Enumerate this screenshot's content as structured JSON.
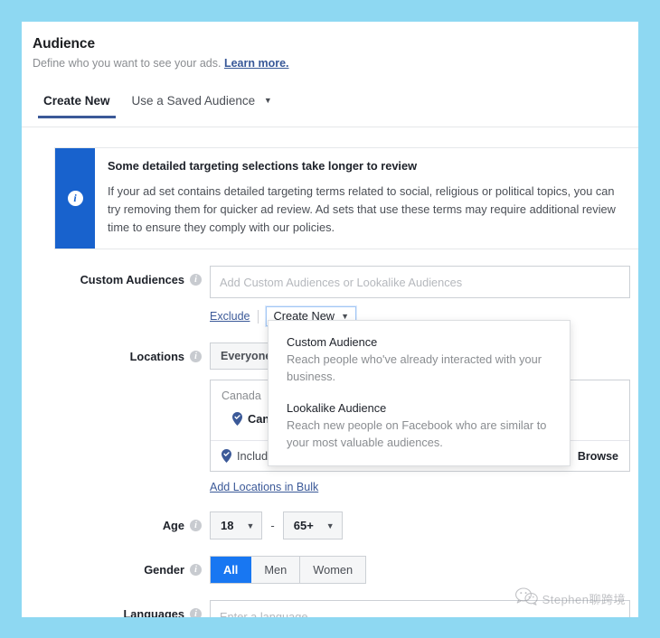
{
  "theme": {
    "page_background": "#8ed8f2",
    "card_background": "#ffffff",
    "brand_blue": "#1877f2",
    "banner_blue": "#1862cd",
    "link_blue": "#3b5998",
    "tab_underline": "#3b5998"
  },
  "header": {
    "title": "Audience",
    "subtitle": "Define who you want to see your ads.",
    "learn_more": "Learn more."
  },
  "tabs": [
    {
      "label": "Create New",
      "active": true
    },
    {
      "label": "Use a Saved Audience",
      "active": false,
      "caret": "▼"
    }
  ],
  "banner": {
    "icon": "info-icon",
    "icon_glyph": "i",
    "title": "Some detailed targeting selections take longer to review",
    "text": "If your ad set contains detailed targeting terms related to social, religious or political topics, you can try removing them for quicker ad review. Ad sets that use these terms may require additional review time to ensure they comply with our policies."
  },
  "custom_audiences": {
    "label": "Custom Audiences",
    "help_icon": "question-mark-icon",
    "placeholder": "Add Custom Audiences or Lookalike Audiences",
    "value": "",
    "exclude_label": "Exclude",
    "create_new_label": "Create New",
    "create_new_caret": "▼"
  },
  "create_new_dropdown": {
    "items": [
      {
        "title": "Custom Audience",
        "description": "Reach people who've already interacted with your business."
      },
      {
        "title": "Lookalike Audience",
        "description": "Reach new people on Facebook who are similar to your most valuable audiences."
      }
    ]
  },
  "locations": {
    "label": "Locations",
    "help_icon": "question-mark-icon",
    "scope_button": "Everyone",
    "country_group": "Canada",
    "selected_chip": "Canada",
    "include_label": "Include",
    "browse_label": "Browse",
    "bulk_link": "Add Locations in Bulk",
    "pin_icon": "map-pin-icon"
  },
  "age": {
    "label": "Age",
    "help_icon": "question-mark-icon",
    "min": "18",
    "max": "65+",
    "separator": "-",
    "caret": "▼"
  },
  "gender": {
    "label": "Gender",
    "help_icon": "question-mark-icon",
    "options": [
      {
        "label": "All",
        "selected": true
      },
      {
        "label": "Men",
        "selected": false
      },
      {
        "label": "Women",
        "selected": false
      }
    ]
  },
  "languages": {
    "label": "Languages",
    "help_icon": "question-mark-icon",
    "placeholder": "Enter a language...",
    "value": ""
  },
  "watermark": {
    "icon": "wechat-icon",
    "text": "Stephen聊跨境"
  }
}
